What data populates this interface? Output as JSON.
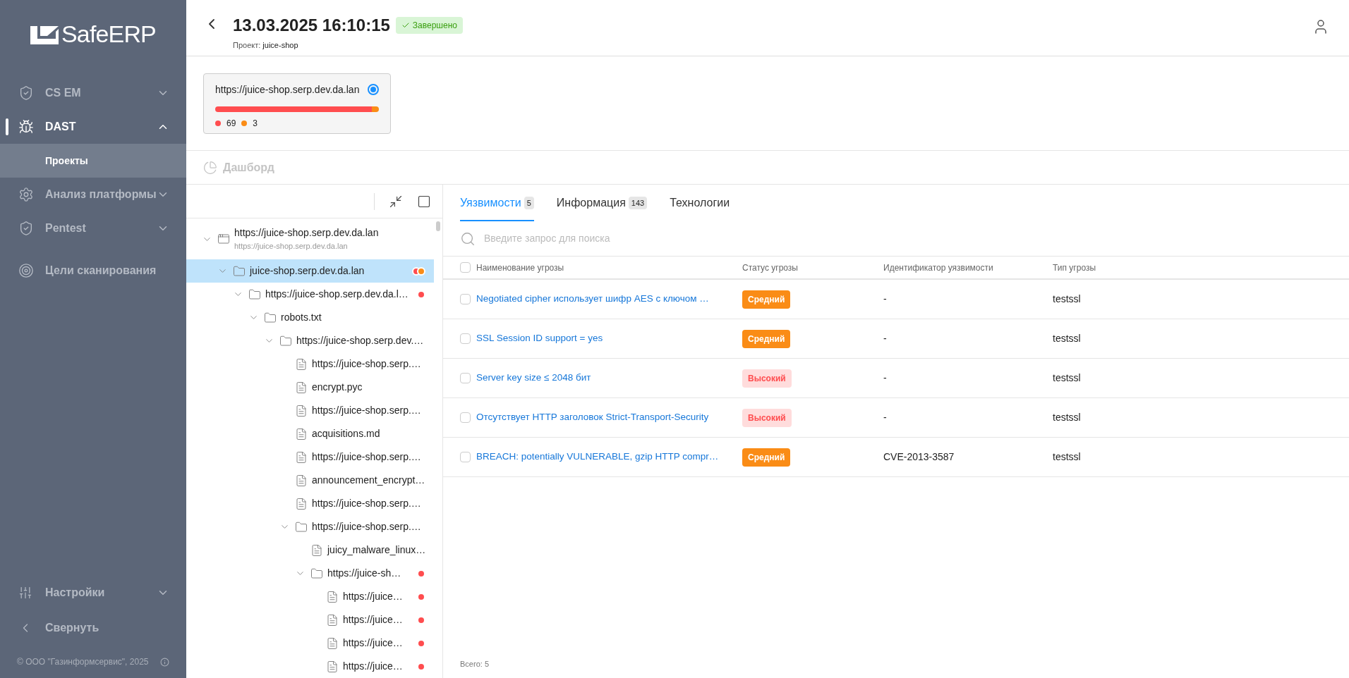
{
  "sidebar": {
    "logo": "SafeERP",
    "items": [
      {
        "label": "CS EM",
        "expanded": false,
        "selected": false
      },
      {
        "label": "DAST",
        "expanded": true,
        "selected": true,
        "children": [
          {
            "label": "Проекты",
            "selected": true
          }
        ]
      },
      {
        "label": "Анализ платформы",
        "expanded": false,
        "selected": false
      },
      {
        "label": "Pentest",
        "expanded": false,
        "selected": false
      },
      {
        "label": "Цели сканирования",
        "selected": false
      }
    ],
    "bottom_items": [
      {
        "label": "Настройки",
        "expanded": false
      },
      {
        "label": "Свернуть"
      }
    ],
    "copyright": "© ООО \"Газинформсервис\", 2025"
  },
  "header": {
    "title": "13.03.2025 16:10:15",
    "status": "Завершено",
    "project_label": "Проект:",
    "project": "juice-shop"
  },
  "targets": [
    {
      "url": "https://juice-shop.serp.dev.da.lan",
      "selected": true,
      "counts": [
        {
          "value": "69",
          "color": "#ff4d4f"
        },
        {
          "value": "3",
          "color": "#fa8c16"
        }
      ]
    }
  ],
  "dashboard_link": "Дашборд",
  "tree": {
    "nodes": [
      {
        "kind": "host",
        "label": "https://juice-shop.serp.dev.da.lan",
        "subtitle": "https://juice-shop.serp.dev.da.lan",
        "expanded": true,
        "selected": false,
        "children": [
          {
            "kind": "folder",
            "label": "juice-shop.serp.dev.da.lan",
            "expanded": true,
            "selected": true,
            "markers": [
              {
                "color": "#ff4d4f"
              },
              {
                "color": "#fa8c16"
              }
            ],
            "children": [
              {
                "kind": "folder",
                "label": "https://juice-shop.serp.dev.da.l…",
                "expanded": true,
                "selected": false,
                "markers": [
                  {
                    "color": "#ff4d4f"
                  }
                ],
                "children": [
                  {
                    "kind": "folder",
                    "label": "robots.txt",
                    "expanded": true,
                    "selected": false,
                    "children": [
                      {
                        "kind": "folder",
                        "label": "https://juice-shop.serp.dev.…",
                        "expanded": true,
                        "selected": false,
                        "children": [
                          {
                            "kind": "file",
                            "label": "https://juice-shop.serp.…",
                            "selected": false
                          },
                          {
                            "kind": "file",
                            "label": "encrypt.pyc",
                            "selected": false
                          },
                          {
                            "kind": "file",
                            "label": "https://juice-shop.serp.…",
                            "selected": false
                          },
                          {
                            "kind": "file",
                            "label": "acquisitions.md",
                            "selected": false
                          },
                          {
                            "kind": "file",
                            "label": "https://juice-shop.serp.…",
                            "selected": false
                          },
                          {
                            "kind": "file",
                            "label": "announcement_encrypt…",
                            "selected": false
                          },
                          {
                            "kind": "file",
                            "label": "https://juice-shop.serp.…",
                            "selected": false
                          },
                          {
                            "kind": "folder",
                            "label": "https://juice-shop.serp.…",
                            "expanded": true,
                            "selected": false,
                            "children": [
                              {
                                "kind": "file",
                                "label": "juicy_malware_linux…",
                                "selected": false
                              },
                              {
                                "kind": "folder",
                                "label": "https://juice-sh…",
                                "expanded": true,
                                "selected": false,
                                "markers": [
                                  {
                                    "color": "#ff4d4f"
                                  }
                                ],
                                "children": [
                                  {
                                    "kind": "file",
                                    "label": "https://juice…",
                                    "selected": false,
                                    "markers": [
                                      {
                                        "color": "#ff4d4f"
                                      }
                                    ]
                                  },
                                  {
                                    "kind": "file",
                                    "label": "https://juice…",
                                    "selected": false,
                                    "markers": [
                                      {
                                        "color": "#ff4d4f"
                                      }
                                    ]
                                  },
                                  {
                                    "kind": "file",
                                    "label": "https://juice…",
                                    "selected": false,
                                    "markers": [
                                      {
                                        "color": "#ff4d4f"
                                      }
                                    ]
                                  },
                                  {
                                    "kind": "file",
                                    "label": "https://juice…",
                                    "selected": false,
                                    "markers": [
                                      {
                                        "color": "#ff4d4f"
                                      }
                                    ]
                                  }
                                ]
                              }
                            ]
                          }
                        ]
                      }
                    ]
                  }
                ]
              }
            ]
          }
        ]
      }
    ]
  },
  "tabs": [
    {
      "label": "Уязвимости",
      "count": "5",
      "selected": true
    },
    {
      "label": "Информация",
      "count": "143",
      "selected": false
    },
    {
      "label": "Технологии",
      "selected": false
    }
  ],
  "search": {
    "placeholder": "Введите запрос для поиска"
  },
  "table": {
    "select_all_checked": false,
    "columns": [
      "Наименование угрозы",
      "Статус угрозы",
      "Идентификатор уязвимости",
      "Тип угрозы"
    ],
    "rows": [
      {
        "checked": false,
        "name": "Negotiated cipher использует шифр AES с ключом …",
        "status": "Средний",
        "kind": "medium",
        "id": "-",
        "type": "testssl"
      },
      {
        "checked": false,
        "name": "SSL Session ID support = yes",
        "status": "Средний",
        "kind": "medium",
        "id": "-",
        "type": "testssl"
      },
      {
        "checked": false,
        "name": "Server key size ≤ 2048 бит",
        "status": "Высокий",
        "kind": "high",
        "id": "-",
        "type": "testssl"
      },
      {
        "checked": false,
        "name": "Отсутствует HTTP заголовок Strict-Transport-Security",
        "status": "Высокий",
        "kind": "high",
        "id": "-",
        "type": "testssl"
      },
      {
        "checked": false,
        "name": "BREACH: potentially VULNERABLE, gzip HTTP compr…",
        "status": "Средний",
        "kind": "medium",
        "id": "CVE-2013-3587",
        "type": "testssl"
      }
    ],
    "total": "Всего: 5"
  }
}
